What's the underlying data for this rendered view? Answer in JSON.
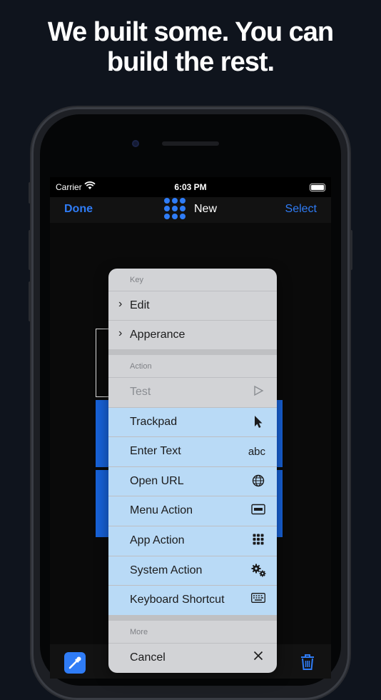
{
  "headline": {
    "line1": "We built some. You can",
    "line2": "build the rest."
  },
  "status_bar": {
    "carrier": "Carrier",
    "time": "6:03 PM"
  },
  "nav": {
    "done": "Done",
    "title": "New",
    "select": "Select"
  },
  "menu": {
    "key_header": "Key",
    "edit": "Edit",
    "appearance": "Apperance",
    "action_header": "Action",
    "items": [
      {
        "label": "Test",
        "icon": "play-icon"
      },
      {
        "label": "Trackpad",
        "icon": "cursor-icon"
      },
      {
        "label": "Enter Text",
        "icon_text": "abc"
      },
      {
        "label": "Open URL",
        "icon": "globe-icon"
      },
      {
        "label": "Menu Action",
        "icon": "menu-bar-icon"
      },
      {
        "label": "App Action",
        "icon": "grid-icon"
      },
      {
        "label": "System Action",
        "icon": "gears-icon"
      },
      {
        "label": "Keyboard Shortcut",
        "icon": "keyboard-icon"
      }
    ],
    "more_header": "More",
    "cancel": "Cancel"
  },
  "colors": {
    "accent": "#2f7cf6",
    "key_blue": "#1762d9",
    "menu_bg": "#d2d3d6",
    "menu_highlight": "#b9daf6"
  }
}
